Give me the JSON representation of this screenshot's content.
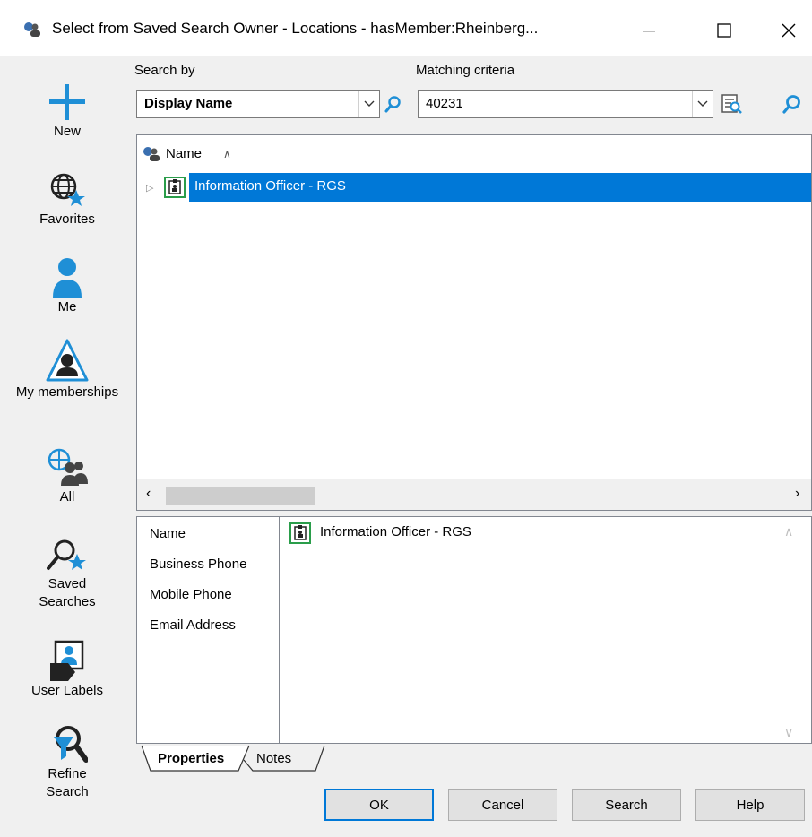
{
  "window": {
    "title": "Select from Saved Search Owner - Locations - hasMember:Rheinberg...",
    "minimize_glyph": "—",
    "maximize_glyph": "☐",
    "close_glyph": "✕"
  },
  "nav": {
    "items": [
      {
        "label": "New",
        "icon": "plus-icon"
      },
      {
        "label": "Favorites",
        "icon": "globe-star-icon"
      },
      {
        "label": "Me",
        "icon": "person-icon"
      },
      {
        "label": "My memberships",
        "icon": "membership-icon"
      },
      {
        "label": "All",
        "icon": "globe-group-icon"
      },
      {
        "label": "Saved Searches",
        "icon": "saved-search-icon"
      },
      {
        "label": "User Labels",
        "icon": "user-label-icon"
      },
      {
        "label": "Refine Search",
        "icon": "refine-search-icon"
      }
    ]
  },
  "search": {
    "search_by_label": "Search by",
    "search_by_value": "Display Name",
    "criteria_label": "Matching criteria",
    "criteria_value": "40231"
  },
  "list": {
    "column_header": "Name",
    "sort_indicator": "∧",
    "rows": [
      {
        "name": "Information Officer - RGS",
        "selected": true
      }
    ]
  },
  "properties": {
    "labels": [
      "Name",
      "Business Phone",
      "Mobile Phone",
      "Email Address"
    ],
    "name_value": "Information Officer - RGS"
  },
  "tabs": [
    "Properties",
    "Notes"
  ],
  "buttons": {
    "ok": "OK",
    "cancel": "Cancel",
    "search": "Search",
    "help": "Help"
  },
  "colors": {
    "selection": "#0078d7",
    "accent_blue": "#1f8fd6"
  }
}
